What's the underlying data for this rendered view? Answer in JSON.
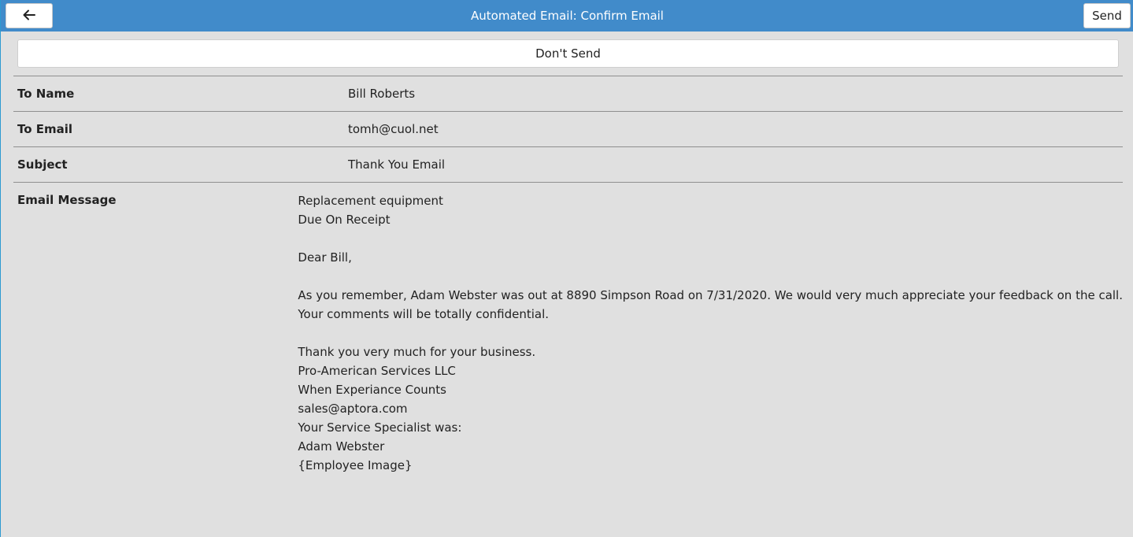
{
  "header": {
    "title": "Automated Email: Confirm Email",
    "send_label": "Send",
    "back_icon": "arrow-left-icon"
  },
  "dont_send_label": "Don't Send",
  "fields": {
    "to_name": {
      "label": "To Name",
      "value": "Bill Roberts"
    },
    "to_email": {
      "label": "To Email",
      "value": "tomh@cuol.net"
    },
    "subject": {
      "label": "Subject",
      "value": "Thank You Email"
    },
    "message": {
      "label": "Email Message",
      "lines": [
        "Replacement equipment",
        "Due On Receipt",
        "",
        "Dear Bill,",
        "",
        "As you remember, Adam Webster was out at 8890 Simpson Road on 7/31/2020. We would very much appreciate your feedback on the call.",
        "Your comments will be totally confidential.",
        "",
        "Thank you very much for your business.",
        "Pro-American Services LLC",
        "When Experiance Counts",
        "sales@aptora.com",
        "Your Service Specialist was:",
        "Adam Webster",
        "{Employee Image}"
      ]
    }
  },
  "colors": {
    "header_bg": "#418bca",
    "page_bg": "#e0e0e0",
    "divider": "#8f8f8f"
  }
}
